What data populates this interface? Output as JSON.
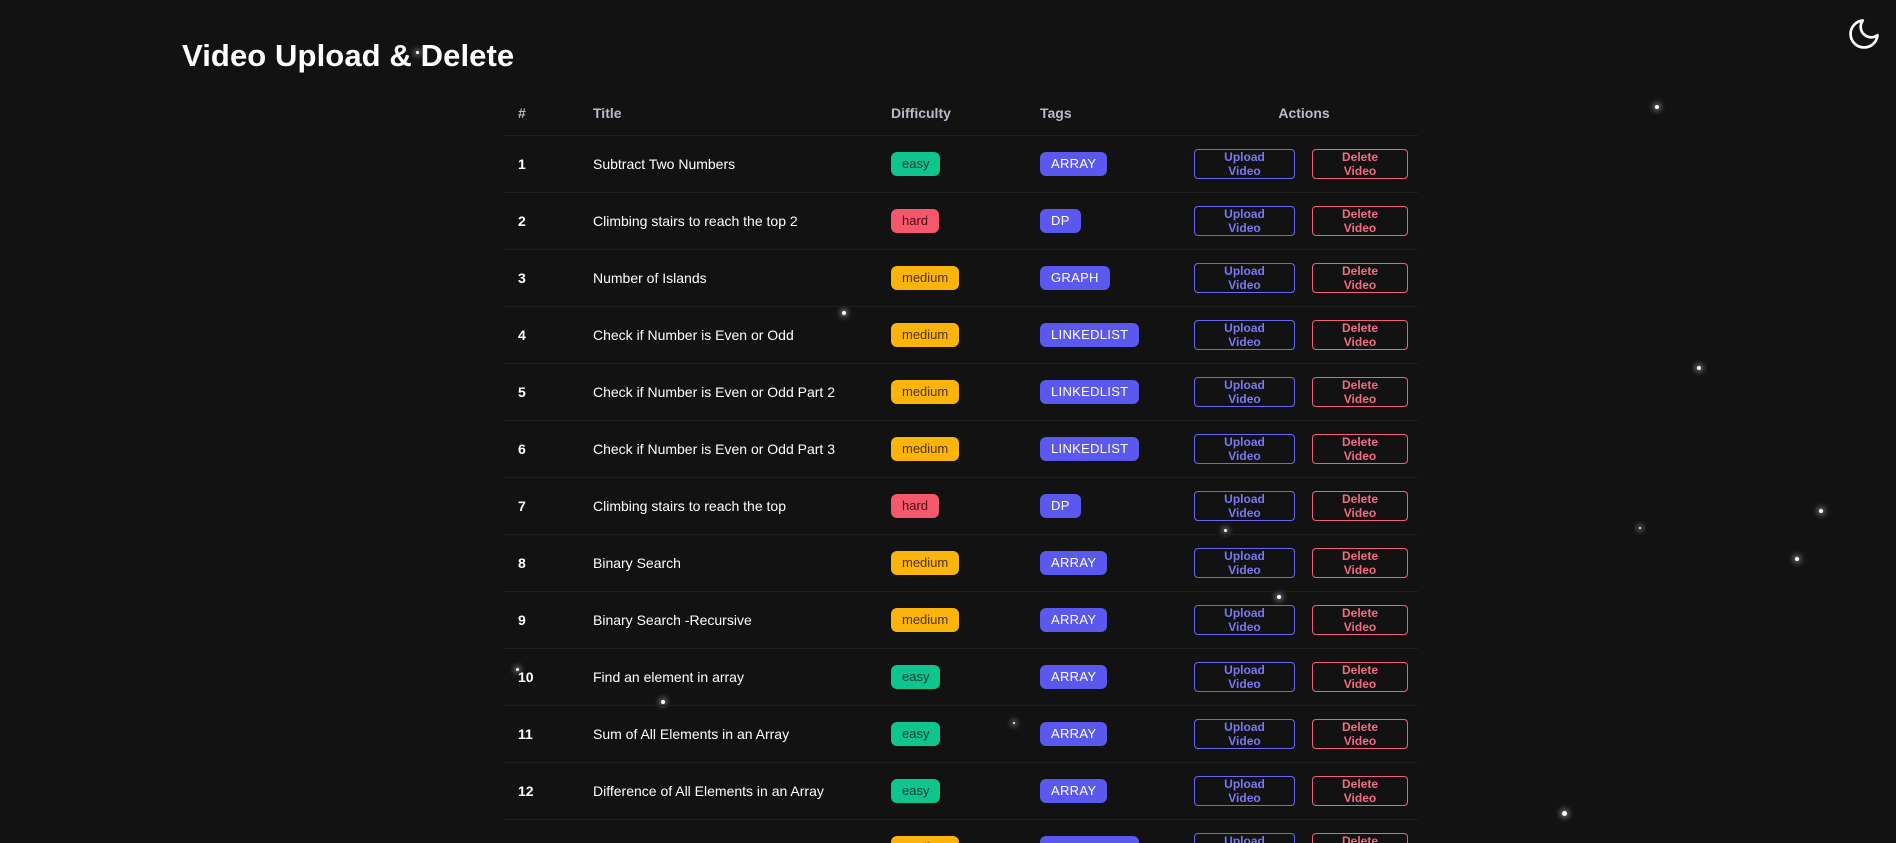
{
  "page": {
    "title": "Video Upload & Delete",
    "theme_toggle_icon": "moon-icon"
  },
  "colors": {
    "background": "#121212",
    "easy": "#10c48e",
    "medium": "#fbb40c",
    "hard": "#f5576c",
    "tag": "#5b58ee",
    "upload": "#6b67f3",
    "delete": "#f0607a"
  },
  "table": {
    "headers": {
      "num": "#",
      "title": "Title",
      "difficulty": "Difficulty",
      "tags": "Tags",
      "actions": "Actions"
    },
    "upload_label": "Upload Video",
    "delete_label": "Delete Video",
    "rows": [
      {
        "num": "1",
        "title": "Subtract Two Numbers",
        "difficulty": "easy",
        "tag": "ARRAY"
      },
      {
        "num": "2",
        "title": "Climbing stairs to reach the top 2",
        "difficulty": "hard",
        "tag": "DP"
      },
      {
        "num": "3",
        "title": "Number of Islands",
        "difficulty": "medium",
        "tag": "GRAPH"
      },
      {
        "num": "4",
        "title": "Check if Number is Even or Odd",
        "difficulty": "medium",
        "tag": "LINKEDLIST"
      },
      {
        "num": "5",
        "title": "Check if Number is Even or Odd Part 2",
        "difficulty": "medium",
        "tag": "LINKEDLIST"
      },
      {
        "num": "6",
        "title": "Check if Number is Even or Odd Part 3",
        "difficulty": "medium",
        "tag": "LINKEDLIST"
      },
      {
        "num": "7",
        "title": "Climbing stairs to reach the top",
        "difficulty": "hard",
        "tag": "DP"
      },
      {
        "num": "8",
        "title": "Binary Search",
        "difficulty": "medium",
        "tag": "ARRAY"
      },
      {
        "num": "9",
        "title": "Binary Search -Recursive",
        "difficulty": "medium",
        "tag": "ARRAY"
      },
      {
        "num": "10",
        "title": "Find an element in array",
        "difficulty": "easy",
        "tag": "ARRAY"
      },
      {
        "num": "11",
        "title": "Sum of All Elements in an Array",
        "difficulty": "easy",
        "tag": "ARRAY"
      },
      {
        "num": "12",
        "title": "Difference of All Elements in an Array",
        "difficulty": "easy",
        "tag": "ARRAY"
      },
      {
        "num": "",
        "title": "",
        "difficulty": "medium",
        "tag": "LINKEDLIST"
      }
    ]
  }
}
